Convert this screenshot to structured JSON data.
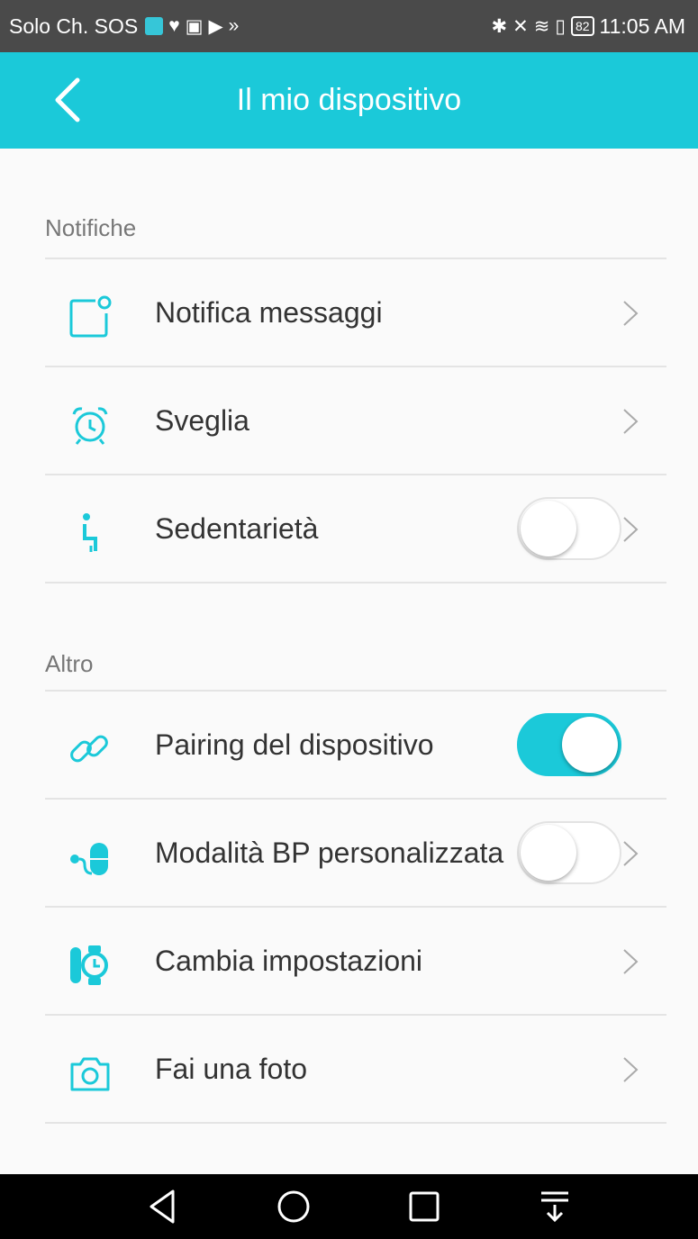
{
  "status_bar": {
    "carrier": "Solo Ch. SOS",
    "battery": "82",
    "time": "11:05 AM"
  },
  "app_bar": {
    "title": "Il mio dispositivo",
    "back_icon": "chevron-left-icon"
  },
  "sections": [
    {
      "label": "Notifiche",
      "items": [
        {
          "label": "Notifica messaggi",
          "icon": "message-notification-icon",
          "toggle": null,
          "chevron": true
        },
        {
          "label": "Sveglia",
          "icon": "alarm-clock-icon",
          "toggle": null,
          "chevron": true
        },
        {
          "label": "Sedentarietà",
          "icon": "sitting-person-icon",
          "toggle": "off",
          "chevron": true
        }
      ]
    },
    {
      "label": "Altro",
      "items": [
        {
          "label": "Pairing del dispositivo",
          "icon": "link-icon",
          "toggle": "on",
          "chevron": false
        },
        {
          "label": "Modalità BP personalizzata",
          "icon": "blood-pressure-icon",
          "toggle": "off",
          "chevron": true
        },
        {
          "label": "Cambia impostazioni",
          "icon": "watch-settings-icon",
          "toggle": null,
          "chevron": true
        },
        {
          "label": "Fai una foto",
          "icon": "camera-icon",
          "toggle": null,
          "chevron": true
        }
      ]
    }
  ],
  "nav_bar": {
    "buttons": [
      "back-triangle-icon",
      "home-circle-icon",
      "recents-square-icon",
      "notification-pull-icon"
    ]
  },
  "colors": {
    "accent": "#1bc9d9",
    "status_bar": "#4a4a4a",
    "background": "#fafafa",
    "nav_bar": "#000000"
  }
}
